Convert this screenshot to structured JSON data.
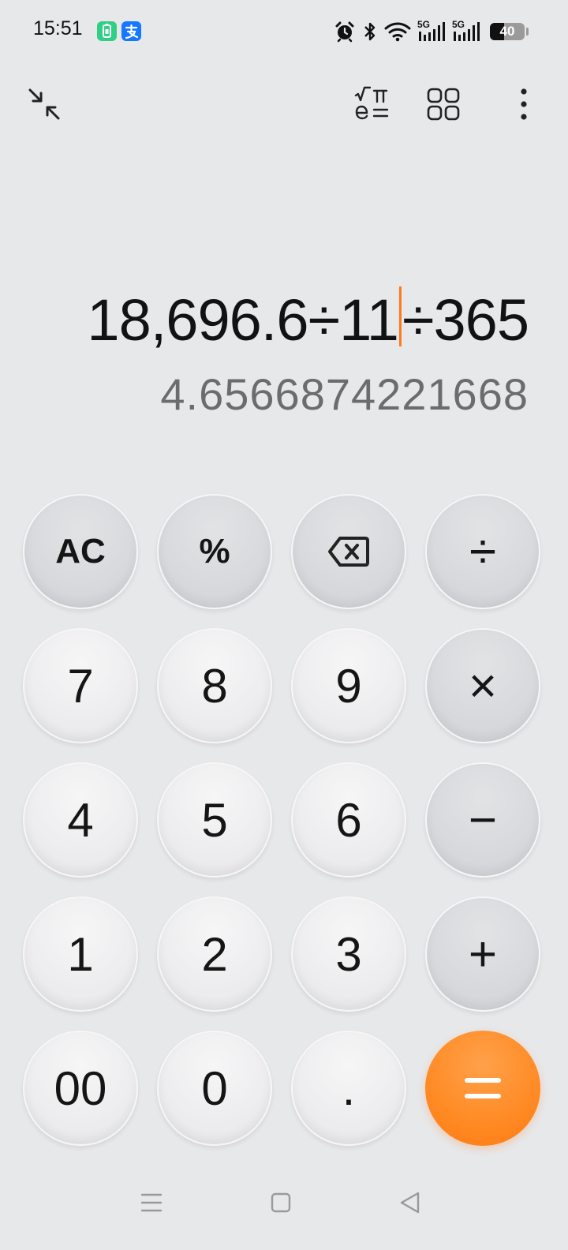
{
  "status_bar": {
    "time": "15:51",
    "battery_level": "40",
    "network_1": "5G",
    "network_2": "5G",
    "app_icons": [
      "phone-charge-app-icon",
      "alipay-app-icon"
    ],
    "colors": {
      "charge_app": "#2fcf86",
      "alipay": "#1677ff"
    }
  },
  "toolbar": {
    "left_icon": "collapse-icon",
    "right_icons": [
      "scientific-mode-icon",
      "converter-grid-icon",
      "more-menu-icon"
    ]
  },
  "display": {
    "expression_before_cursor": "18,696.6÷11",
    "expression_after_cursor": "÷365",
    "result": "4.6566874221668",
    "cursor_color": "#ff7a1a"
  },
  "keypad": {
    "rows": [
      [
        {
          "label": "AC",
          "kind": "fn",
          "name": "ac-button"
        },
        {
          "label": "%",
          "kind": "fn",
          "name": "percent-button"
        },
        {
          "label": "",
          "kind": "fn",
          "name": "backspace-button",
          "icon": "backspace-icon"
        },
        {
          "label": "÷",
          "kind": "op",
          "name": "divide-button"
        }
      ],
      [
        {
          "label": "7",
          "kind": "num",
          "name": "key-7"
        },
        {
          "label": "8",
          "kind": "num",
          "name": "key-8"
        },
        {
          "label": "9",
          "kind": "num",
          "name": "key-9"
        },
        {
          "label": "×",
          "kind": "op",
          "name": "multiply-button"
        }
      ],
      [
        {
          "label": "4",
          "kind": "num",
          "name": "key-4"
        },
        {
          "label": "5",
          "kind": "num",
          "name": "key-5"
        },
        {
          "label": "6",
          "kind": "num",
          "name": "key-6"
        },
        {
          "label": "−",
          "kind": "op",
          "name": "minus-button"
        }
      ],
      [
        {
          "label": "1",
          "kind": "num",
          "name": "key-1"
        },
        {
          "label": "2",
          "kind": "num",
          "name": "key-2"
        },
        {
          "label": "3",
          "kind": "num",
          "name": "key-3"
        },
        {
          "label": "+",
          "kind": "op",
          "name": "plus-button"
        }
      ],
      [
        {
          "label": "00",
          "kind": "num",
          "name": "key-00"
        },
        {
          "label": "0",
          "kind": "num",
          "name": "key-0"
        },
        {
          "label": ".",
          "kind": "num",
          "name": "decimal-button"
        },
        {
          "label": "=",
          "kind": "eq",
          "name": "equals-button"
        }
      ]
    ],
    "colors": {
      "equals": "#ff8a24"
    }
  },
  "nav_bar": {
    "icons": [
      "menu-nav-icon",
      "home-nav-icon",
      "back-nav-icon"
    ]
  }
}
